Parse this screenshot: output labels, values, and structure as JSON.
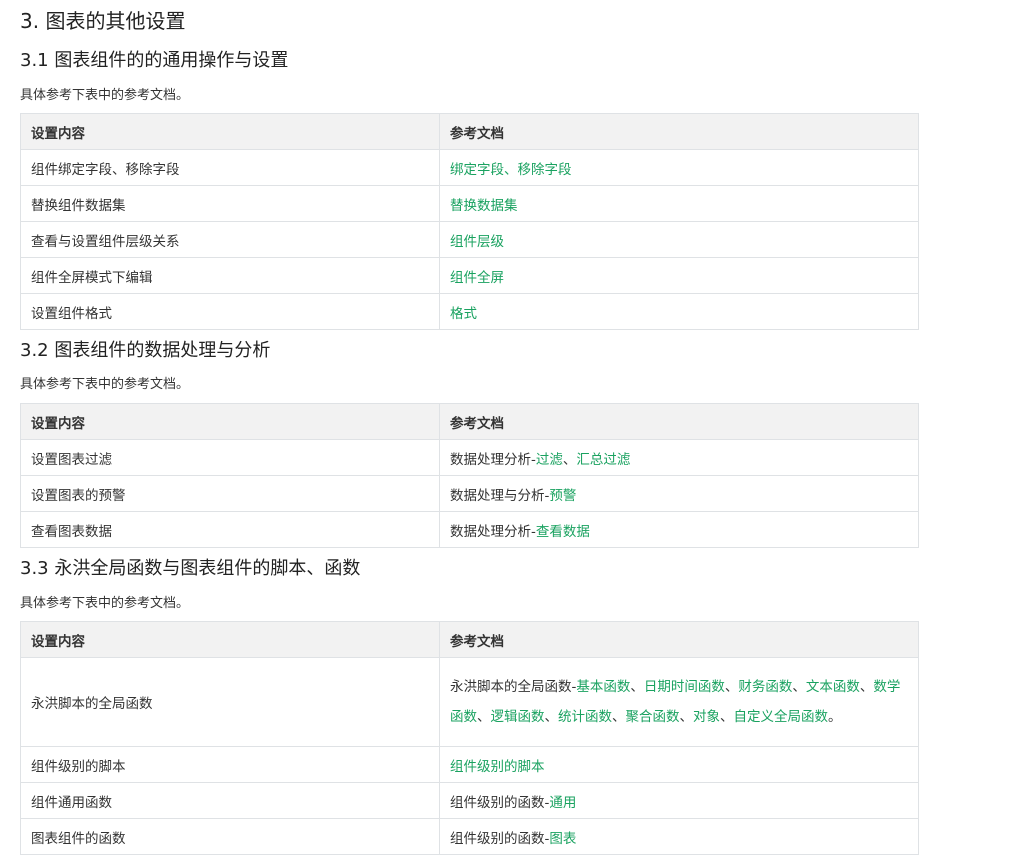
{
  "heading_main": "3. 图表的其他设置",
  "sections": [
    {
      "title": "3.1 图表组件的的通用操作与设置",
      "intro": "具体参考下表中的参考文档。",
      "headers": [
        "设置内容",
        "参考文档"
      ],
      "rows": [
        {
          "left": "组件绑定字段、移除字段",
          "right": [
            {
              "t": "绑定字段、移除字段",
              "link": true
            }
          ]
        },
        {
          "left": "替换组件数据集",
          "right": [
            {
              "t": "替换数据集",
              "link": true
            }
          ]
        },
        {
          "left": "查看与设置组件层级关系",
          "right": [
            {
              "t": "组件层级",
              "link": true
            }
          ]
        },
        {
          "left": "组件全屏模式下编辑",
          "right": [
            {
              "t": "组件全屏",
              "link": true
            }
          ]
        },
        {
          "left": "设置组件格式",
          "right": [
            {
              "t": "格式",
              "link": true
            }
          ]
        }
      ]
    },
    {
      "title": "3.2 图表组件的数据处理与分析",
      "intro": "具体参考下表中的参考文档。",
      "headers": [
        "设置内容",
        "参考文档"
      ],
      "rows": [
        {
          "left": "设置图表过滤",
          "right": [
            {
              "t": "数据处理分析-",
              "link": false
            },
            {
              "t": "过滤",
              "link": true
            },
            {
              "t": "、",
              "link": false
            },
            {
              "t": "汇总过滤",
              "link": true
            }
          ]
        },
        {
          "left": "设置图表的预警",
          "right": [
            {
              "t": "数据处理与分析-",
              "link": false
            },
            {
              "t": "预警",
              "link": true
            }
          ]
        },
        {
          "left": "查看图表数据",
          "right": [
            {
              "t": "数据处理分析-",
              "link": false
            },
            {
              "t": "查看数据",
              "link": true
            }
          ]
        }
      ]
    },
    {
      "title": "3.3 永洪全局函数与图表组件的脚本、函数",
      "intro": "具体参考下表中的参考文档。",
      "headers": [
        "设置内容",
        "参考文档"
      ],
      "rows": [
        {
          "left": "永洪脚本的全局函数",
          "tall": true,
          "right": [
            {
              "t": "永洪脚本的全局函数-",
              "link": false
            },
            {
              "t": "基本函数",
              "link": true
            },
            {
              "t": "、",
              "link": false
            },
            {
              "t": "日期时间函数",
              "link": true
            },
            {
              "t": "、",
              "link": false
            },
            {
              "t": "财务函数",
              "link": true
            },
            {
              "t": "、",
              "link": false
            },
            {
              "t": "文本函数",
              "link": true
            },
            {
              "t": "、",
              "link": false
            },
            {
              "t": "数学函数",
              "link": true
            },
            {
              "t": "、",
              "link": false
            },
            {
              "t": "逻辑函数",
              "link": true
            },
            {
              "t": "、",
              "link": false
            },
            {
              "t": "统计函数",
              "link": true
            },
            {
              "t": "、",
              "link": false
            },
            {
              "t": "聚合函数",
              "link": true
            },
            {
              "t": "、",
              "link": false
            },
            {
              "t": "对象",
              "link": true
            },
            {
              "t": "、",
              "link": false
            },
            {
              "t": "自定义全局函数",
              "link": true
            },
            {
              "t": "。",
              "link": false
            }
          ]
        },
        {
          "left": "组件级别的脚本",
          "right": [
            {
              "t": "组件级别的脚本",
              "link": true
            }
          ]
        },
        {
          "left": "组件通用函数",
          "right": [
            {
              "t": "组件级别的函数-",
              "link": false
            },
            {
              "t": "通用",
              "link": true
            }
          ]
        },
        {
          "left": "图表组件的函数",
          "right": [
            {
              "t": "组件级别的函数-",
              "link": false
            },
            {
              "t": "图表",
              "link": true
            }
          ]
        }
      ]
    }
  ]
}
